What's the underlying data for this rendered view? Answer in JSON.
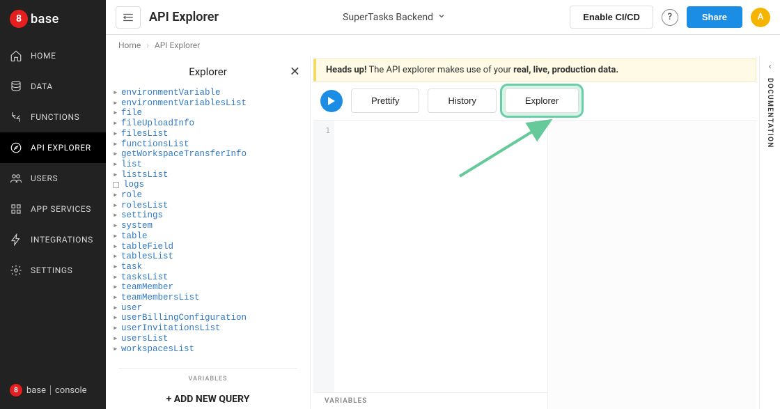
{
  "brand": {
    "badge": "8",
    "name": "base"
  },
  "sidebar": {
    "items": [
      {
        "label": "HOME",
        "icon": "home"
      },
      {
        "label": "DATA",
        "icon": "database"
      },
      {
        "label": "FUNCTIONS",
        "icon": "functions"
      },
      {
        "label": "API EXPLORER",
        "icon": "compass",
        "active": true
      },
      {
        "label": "USERS",
        "icon": "users"
      },
      {
        "label": "APP SERVICES",
        "icon": "services"
      },
      {
        "label": "INTEGRATIONS",
        "icon": "bolt"
      },
      {
        "label": "SETTINGS",
        "icon": "gear"
      }
    ],
    "footer": {
      "badge": "8",
      "name": "base",
      "suffix": "console"
    }
  },
  "topbar": {
    "title": "API Explorer",
    "workspace": "SuperTasks Backend",
    "enable_cicd": "Enable CI/CD",
    "help": "?",
    "share": "Share",
    "avatar_initial": "A"
  },
  "breadcrumb": {
    "home": "Home",
    "current": "API Explorer"
  },
  "explorer_panel": {
    "title": "Explorer",
    "items": [
      {
        "label": "environmentVariable"
      },
      {
        "label": "environmentVariablesList"
      },
      {
        "label": "file"
      },
      {
        "label": "fileUploadInfo"
      },
      {
        "label": "filesList"
      },
      {
        "label": "functionsList"
      },
      {
        "label": "getWorkspaceTransferInfo"
      },
      {
        "label": "list"
      },
      {
        "label": "listsList"
      },
      {
        "label": "logs",
        "checkbox": true
      },
      {
        "label": "role"
      },
      {
        "label": "rolesList"
      },
      {
        "label": "settings"
      },
      {
        "label": "system"
      },
      {
        "label": "table"
      },
      {
        "label": "tableField"
      },
      {
        "label": "tablesList"
      },
      {
        "label": "task"
      },
      {
        "label": "tasksList"
      },
      {
        "label": "teamMember"
      },
      {
        "label": "teamMembersList"
      },
      {
        "label": "user"
      },
      {
        "label": "userBillingConfiguration"
      },
      {
        "label": "userInvitationsList"
      },
      {
        "label": "usersList"
      },
      {
        "label": "workspacesList"
      }
    ],
    "variables_label": "VARIABLES",
    "add_query": "+ ADD NEW QUERY"
  },
  "warning": {
    "prefix": "Heads up!",
    "middle": " The API explorer makes use of your ",
    "emph": "real, live, production data."
  },
  "toolbar": {
    "prettify": "Prettify",
    "history": "History",
    "explorer": "Explorer"
  },
  "editor": {
    "line_number": "1",
    "variables_label": "VARIABLES"
  },
  "doc_rail": {
    "label": "DOCUMENTATION"
  }
}
